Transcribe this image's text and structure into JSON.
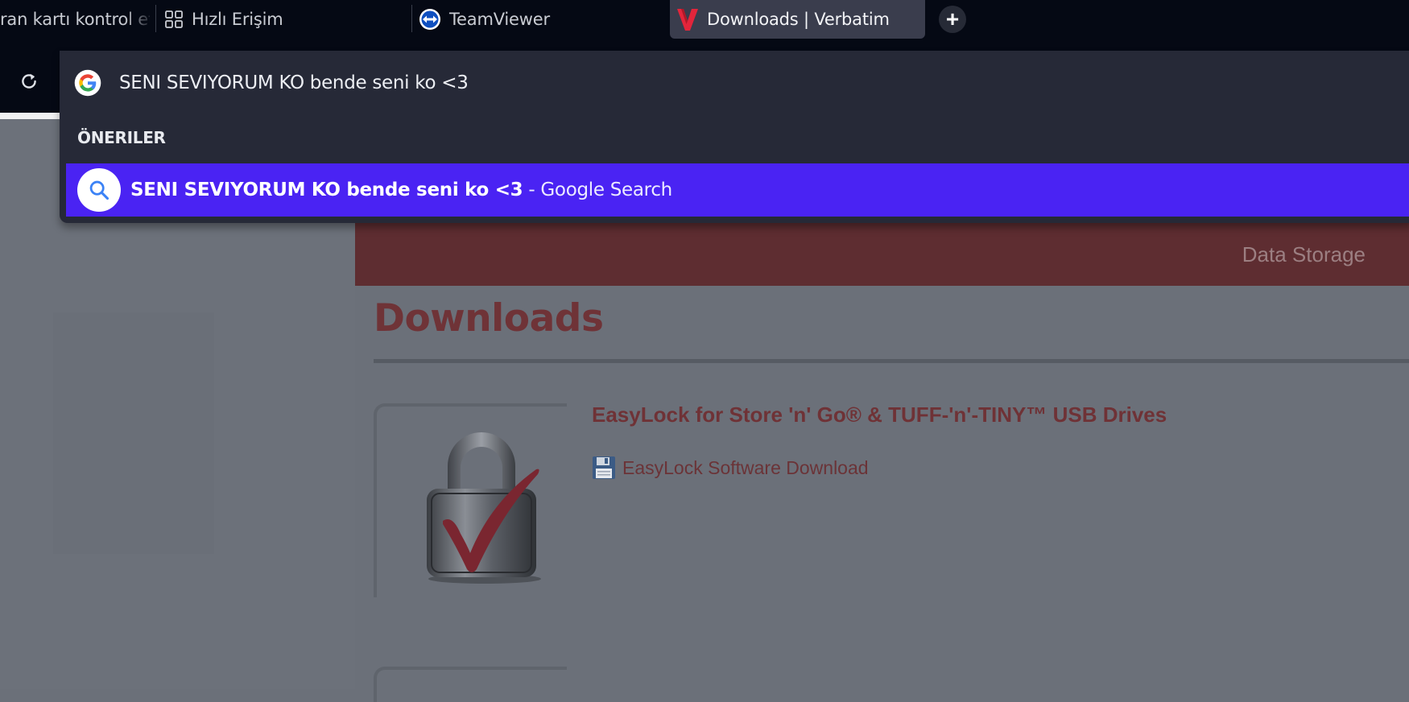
{
  "tabs": [
    {
      "label": "ran kartı kontrol et",
      "icon": "none"
    },
    {
      "label": "Hızlı Erişim",
      "icon": "grid-icon"
    },
    {
      "label": "TeamViewer",
      "icon": "teamviewer-icon"
    },
    {
      "label": "Downloads | Verbatim",
      "icon": "verbatim-icon",
      "active": true
    }
  ],
  "toolbar": {
    "reload_icon": "reload-icon",
    "new_tab_label": "+"
  },
  "omnibox": {
    "engine_icon": "google-icon",
    "input_value": "SENI SEVIYORUM KO bende seni ko <3",
    "suggestions_header": "ÖNERILER",
    "suggestion": {
      "query": "SENI SEVIYORUM KO bende seni ko <3",
      "separator": " - ",
      "engine": "Google Search",
      "icon": "search-icon"
    },
    "highlight_color": "#4a23f3"
  },
  "page": {
    "nav_link": "Data Storage",
    "title": "Downloads",
    "product": {
      "title": "EasyLock for Store 'n' Go® & TUFF-'n'-TINY™ USB Drives",
      "download_label": "EasyLock Software Download",
      "image_icon": "padlock-check-icon",
      "download_icon": "floppy-disk-icon"
    },
    "brand_color": "#c8102e"
  }
}
